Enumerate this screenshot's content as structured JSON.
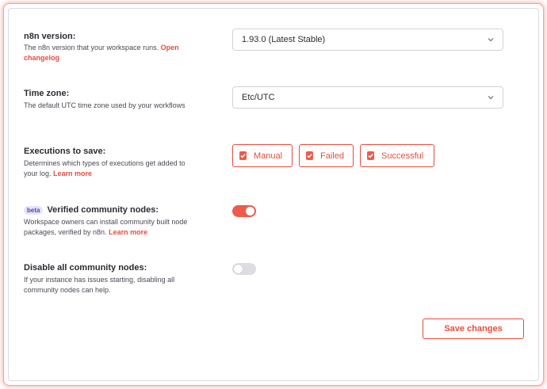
{
  "n8n_version": {
    "label": "n8n version:",
    "description": "The n8n version that your workspace runs.",
    "link": "Open changelog",
    "selected": "1.93.0 (Latest Stable)"
  },
  "time_zone": {
    "label": "Time zone:",
    "description": "The default UTC time zone used by your workflows",
    "selected": "Etc/UTC"
  },
  "executions": {
    "label": "Executions to save:",
    "description": "Determines which types of executions get added to your log.",
    "link": "Learn more",
    "options": [
      {
        "label": "Manual",
        "checked": true
      },
      {
        "label": "Failed",
        "checked": true
      },
      {
        "label": "Successful",
        "checked": true
      }
    ]
  },
  "verified_nodes": {
    "badge": "beta",
    "label": "Verified community nodes:",
    "description": "Workspace owners can install community built node packages, verified by n8n.",
    "link": "Learn more",
    "enabled": true
  },
  "disable_nodes": {
    "label": "Disable all community nodes:",
    "description": "If your instance has issues starting, disabling all community nodes can help.",
    "enabled": false
  },
  "actions": {
    "save_label": "Save changes"
  },
  "colors": {
    "accent": "#ea4b3c",
    "beta_bg": "#e6e4fb",
    "beta_text": "#4d4aa8"
  },
  "icons": {
    "select": "chevron-down-icon",
    "check": "check-icon"
  }
}
